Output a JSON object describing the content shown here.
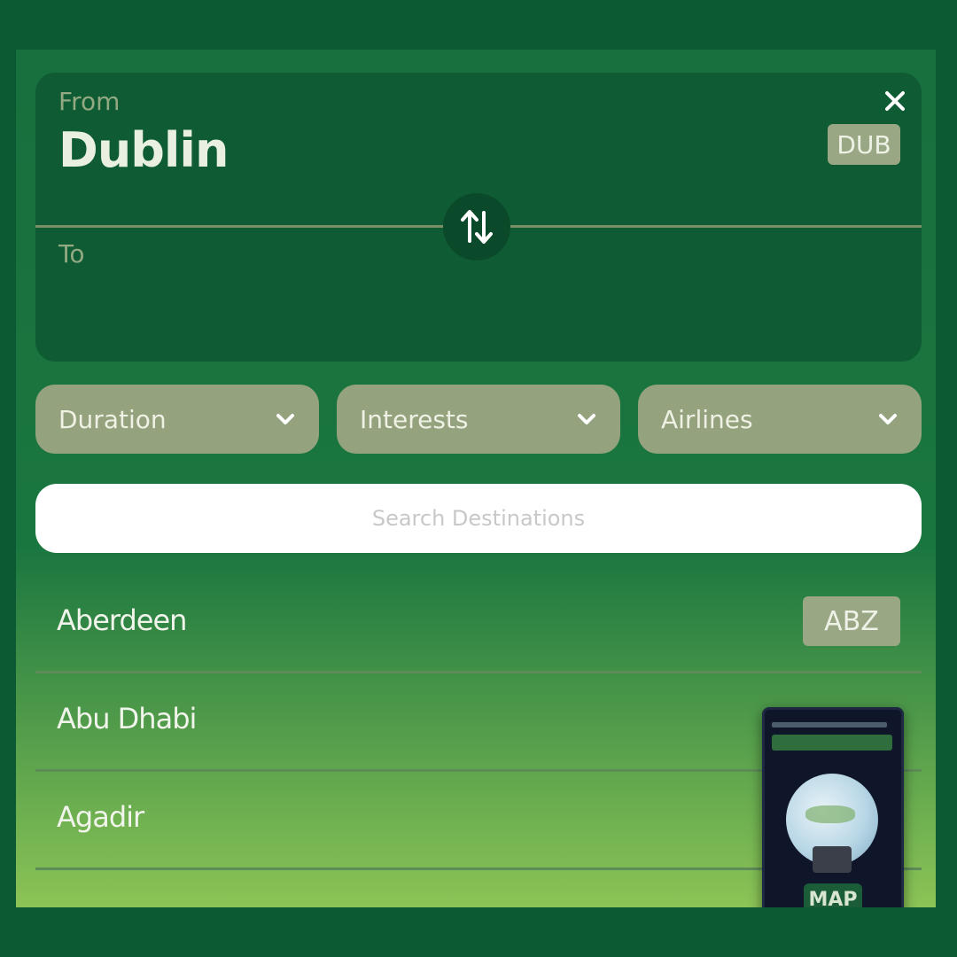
{
  "route": {
    "from_label": "From",
    "from_city": "Dublin",
    "from_code": "DUB",
    "to_label": "To"
  },
  "filters": [
    {
      "label": "Duration"
    },
    {
      "label": "Interests"
    },
    {
      "label": "Airlines"
    }
  ],
  "search": {
    "placeholder": "Search Destinations"
  },
  "destinations": [
    {
      "name": "Aberdeen",
      "code": "ABZ"
    },
    {
      "name": "Abu Dhabi",
      "code": ""
    },
    {
      "name": "Agadir",
      "code": ""
    }
  ],
  "map_preview": {
    "button_label": "MAP"
  },
  "icons": {
    "close": "close-icon",
    "swap": "swap-icon",
    "chevron": "chevron-down-icon"
  },
  "colors": {
    "background": "#0b5a34",
    "card": "#0e5b34",
    "chip": "#9aa784",
    "filter": "#94a27e"
  }
}
